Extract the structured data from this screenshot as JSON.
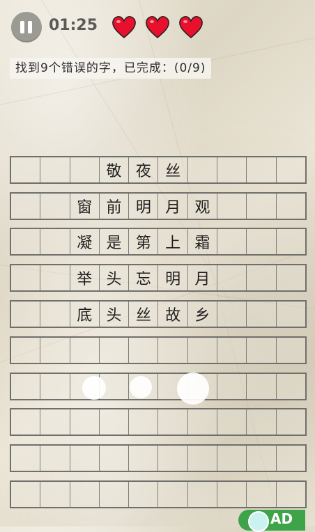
{
  "header": {
    "timer": "01:25",
    "lives": 3,
    "heart_color": "#e8102c"
  },
  "task": {
    "text": "找到9个错误的字，已完成：(0/9)"
  },
  "grid": {
    "columns": 10,
    "rows": [
      [
        "",
        "",
        "",
        "敬",
        "夜",
        "丝",
        "",
        "",
        "",
        ""
      ],
      [
        "",
        "",
        "窗",
        "前",
        "明",
        "月",
        "观",
        "",
        "",
        ""
      ],
      [
        "",
        "",
        "凝",
        "是",
        "第",
        "上",
        "霜",
        "",
        "",
        ""
      ],
      [
        "",
        "",
        "举",
        "头",
        "忘",
        "明",
        "月",
        "",
        "",
        ""
      ],
      [
        "",
        "",
        "底",
        "头",
        "丝",
        "故",
        "乡",
        "",
        "",
        ""
      ],
      [
        "",
        "",
        "",
        "",
        "",
        "",
        "",
        "",
        "",
        ""
      ],
      [
        "",
        "",
        "",
        "",
        "",
        "",
        "",
        "",
        "",
        ""
      ],
      [
        "",
        "",
        "",
        "",
        "",
        "",
        "",
        "",
        "",
        ""
      ],
      [
        "",
        "",
        "",
        "",
        "",
        "",
        "",
        "",
        "",
        ""
      ],
      [
        "",
        "",
        "",
        "",
        "",
        "",
        "",
        "",
        "",
        ""
      ]
    ]
  },
  "ad": {
    "label": "AD",
    "color": "#3fa34a"
  }
}
